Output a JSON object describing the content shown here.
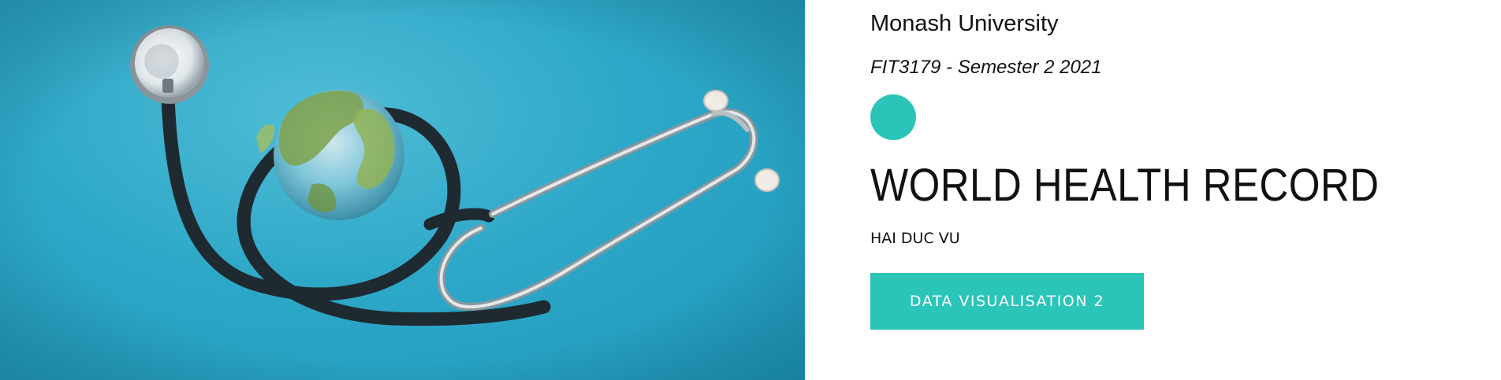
{
  "header": {
    "university": "Monash University",
    "course": "FIT3179 - Semester 2 2021"
  },
  "main": {
    "title": "WORLD HEALTH RECORD",
    "author": "HAI DUC VU",
    "button_label": "DATA VISUALISATION 2"
  },
  "hero": {
    "icon": "stethoscope-with-globe-photo"
  },
  "colors": {
    "accent": "#2bc4b8",
    "hero_background": "#2ea8c8",
    "text": "#111111"
  }
}
